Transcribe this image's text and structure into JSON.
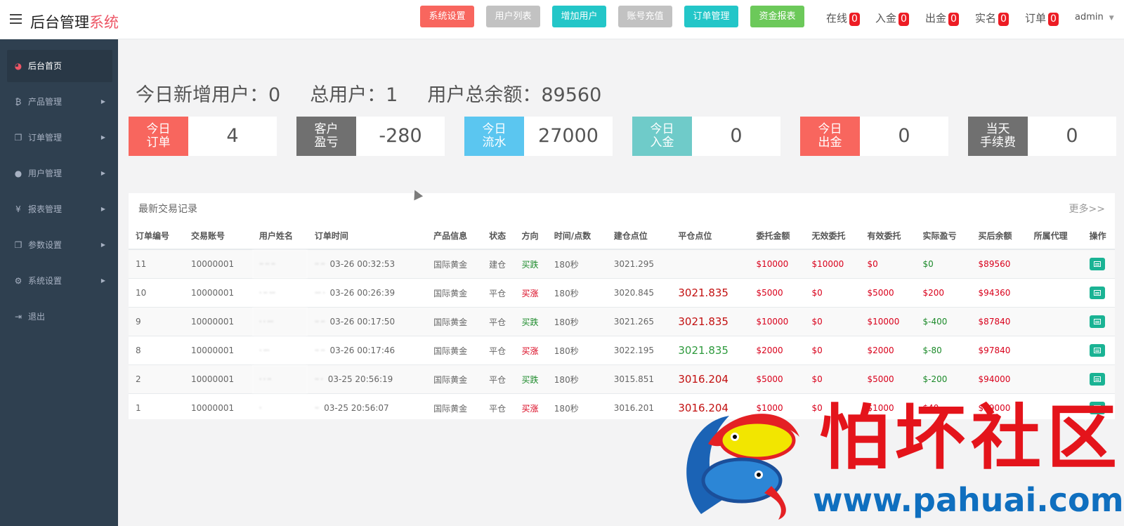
{
  "header": {
    "brand_main": "后台管理",
    "brand_accent": "系统",
    "buttons": [
      {
        "label": "系统设置",
        "color": "#f8665e"
      },
      {
        "label": "用户列表",
        "color": "#c2c2c2"
      },
      {
        "label": "增加用户",
        "color": "#23c6c8"
      },
      {
        "label": "账号充值",
        "color": "#c2c2c2"
      },
      {
        "label": "订单管理",
        "color": "#23c6c8"
      },
      {
        "label": "资金报表",
        "color": "#6cc95a"
      }
    ],
    "stats": [
      {
        "label": "在线",
        "count": "0"
      },
      {
        "label": "入金",
        "count": "0"
      },
      {
        "label": "出金",
        "count": "0"
      },
      {
        "label": "实名",
        "count": "0"
      },
      {
        "label": "订单",
        "count": "0"
      }
    ],
    "user": "admin"
  },
  "sidebar": {
    "items": [
      {
        "label": "后台首页",
        "icon": "dashboard-icon"
      },
      {
        "label": "产品管理",
        "icon": "bitcoin-icon"
      },
      {
        "label": "订单管理",
        "icon": "copy-icon"
      },
      {
        "label": "用户管理",
        "icon": "user-icon"
      },
      {
        "label": "报表管理",
        "icon": "yen-icon"
      },
      {
        "label": "参数设置",
        "icon": "copy-icon"
      },
      {
        "label": "系统设置",
        "icon": "gears-icon"
      },
      {
        "label": "退出",
        "icon": "sign-out-icon"
      }
    ]
  },
  "summary": {
    "new_users": "今日新增用户：0",
    "total_users": "总用户：1",
    "total_balance": "用户总余额：89560"
  },
  "cards": [
    {
      "line1": "今日",
      "line2": "订单",
      "value": "4",
      "color": "#f8665e"
    },
    {
      "line1": "客户",
      "line2": "盈亏",
      "value": "-280",
      "color": "#707070"
    },
    {
      "line1": "今日",
      "line2": "流水",
      "value": "27000",
      "color": "#5bc6f0"
    },
    {
      "line1": "今日",
      "line2": "入金",
      "value": "0",
      "color": "#6fcbc9"
    },
    {
      "line1": "今日",
      "line2": "出金",
      "value": "0",
      "color": "#f8665e"
    },
    {
      "line1": "当天",
      "line2": "手续费",
      "value": "0",
      "color": "#707070"
    }
  ],
  "table": {
    "title": "最新交易记录",
    "more": "更多>>",
    "headers": [
      "订单编号",
      "交易账号",
      "用户姓名",
      "订单时间",
      "产品信息",
      "状态",
      "方向",
      "时间/点数",
      "建仓点位",
      "平仓点位",
      "委托金额",
      "无效委托",
      "有效委托",
      "实际盈亏",
      "买后余额",
      "所属代理",
      "操作"
    ],
    "rows": [
      {
        "id": "11",
        "account": "10000001",
        "name": "·· ·· ··",
        "time_prefix": "·· ··",
        "time": "03-26 00:32:53",
        "product": "国际黄金",
        "status": "建仓",
        "direction": "买跌",
        "dir_color": "green",
        "period": "180秒",
        "open": "3021.295",
        "close": "",
        "close_color": "red",
        "entrust": "$10000",
        "invalid": "$10000",
        "valid": "$0",
        "pnl": "$0",
        "pnl_color": "green",
        "balance": "$89560",
        "agent": ""
      },
      {
        "id": "10",
        "account": "10000001",
        "name": "· ·· ···",
        "time_prefix": "··· ·",
        "time": "03-26 00:26:39",
        "product": "国际黄金",
        "status": "平仓",
        "direction": "买涨",
        "dir_color": "red",
        "period": "180秒",
        "open": "3020.845",
        "close": "3021.835",
        "close_color": "red",
        "entrust": "$5000",
        "invalid": "$0",
        "valid": "$5000",
        "pnl": "$200",
        "pnl_color": "red",
        "balance": "$94360",
        "agent": ""
      },
      {
        "id": "9",
        "account": "10000001",
        "name": "· · ···",
        "time_prefix": "·· ··",
        "time": "03-26 00:17:50",
        "product": "国际黄金",
        "status": "平仓",
        "direction": "买跌",
        "dir_color": "green",
        "period": "180秒",
        "open": "3021.265",
        "close": "3021.835",
        "close_color": "red",
        "entrust": "$10000",
        "invalid": "$0",
        "valid": "$10000",
        "pnl": "$-400",
        "pnl_color": "green",
        "balance": "$87840",
        "agent": ""
      },
      {
        "id": "8",
        "account": "10000001",
        "name": "· ···",
        "time_prefix": "·· ··",
        "time": "03-26 00:17:46",
        "product": "国际黄金",
        "status": "平仓",
        "direction": "买涨",
        "dir_color": "red",
        "period": "180秒",
        "open": "3022.195",
        "close": "3021.835",
        "close_color": "green",
        "entrust": "$2000",
        "invalid": "$0",
        "valid": "$2000",
        "pnl": "$-80",
        "pnl_color": "green",
        "balance": "$97840",
        "agent": ""
      },
      {
        "id": "2",
        "account": "10000001",
        "name": "· · ··",
        "time_prefix": "·· ·",
        "time": "03-25 20:56:19",
        "product": "国际黄金",
        "status": "平仓",
        "direction": "买跌",
        "dir_color": "green",
        "period": "180秒",
        "open": "3015.851",
        "close": "3016.204",
        "close_color": "red",
        "entrust": "$5000",
        "invalid": "$0",
        "valid": "$5000",
        "pnl": "$-200",
        "pnl_color": "green",
        "balance": "$94000",
        "agent": ""
      },
      {
        "id": "1",
        "account": "10000001",
        "name": "  ·",
        "time_prefix": "··",
        "time": "03-25 20:56:07",
        "product": "国际黄金",
        "status": "平仓",
        "direction": "买涨",
        "dir_color": "red",
        "period": "180秒",
        "open": "3016.201",
        "close": "3016.204",
        "close_color": "red",
        "entrust": "$1000",
        "invalid": "$0",
        "valid": "$1000",
        "pnl": "$40",
        "pnl_color": "red",
        "balance": "$99000",
        "agent": ""
      }
    ]
  },
  "watermark": {
    "text": "怕坏社区",
    "url": "www.pahuai.com"
  }
}
